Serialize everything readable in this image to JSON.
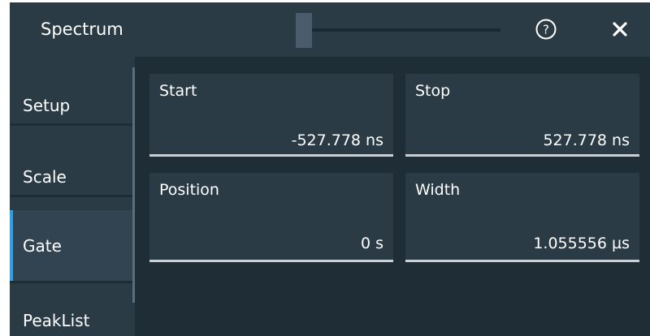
{
  "dialog": {
    "title": "Spectrum"
  },
  "titlebar": {
    "slider_value": 0,
    "help_icon": "help-circle-icon",
    "close_icon": "close-icon"
  },
  "sidebar": {
    "items": [
      {
        "label": "Setup",
        "active": false
      },
      {
        "label": "Scale",
        "active": false
      },
      {
        "label": "Gate",
        "active": true
      },
      {
        "label": "PeakList",
        "active": false
      }
    ]
  },
  "fields": {
    "start": {
      "label": "Start",
      "value": "-527.778 ns"
    },
    "stop": {
      "label": "Stop",
      "value": "527.778 ns"
    },
    "position": {
      "label": "Position",
      "value": "0 s"
    },
    "width": {
      "label": "Width",
      "value": "1.055556 µs"
    }
  },
  "colors": {
    "background": "#1f2d36",
    "panel": "#2b3b46",
    "accent": "#2f9fe6",
    "text": "#ffffff"
  }
}
